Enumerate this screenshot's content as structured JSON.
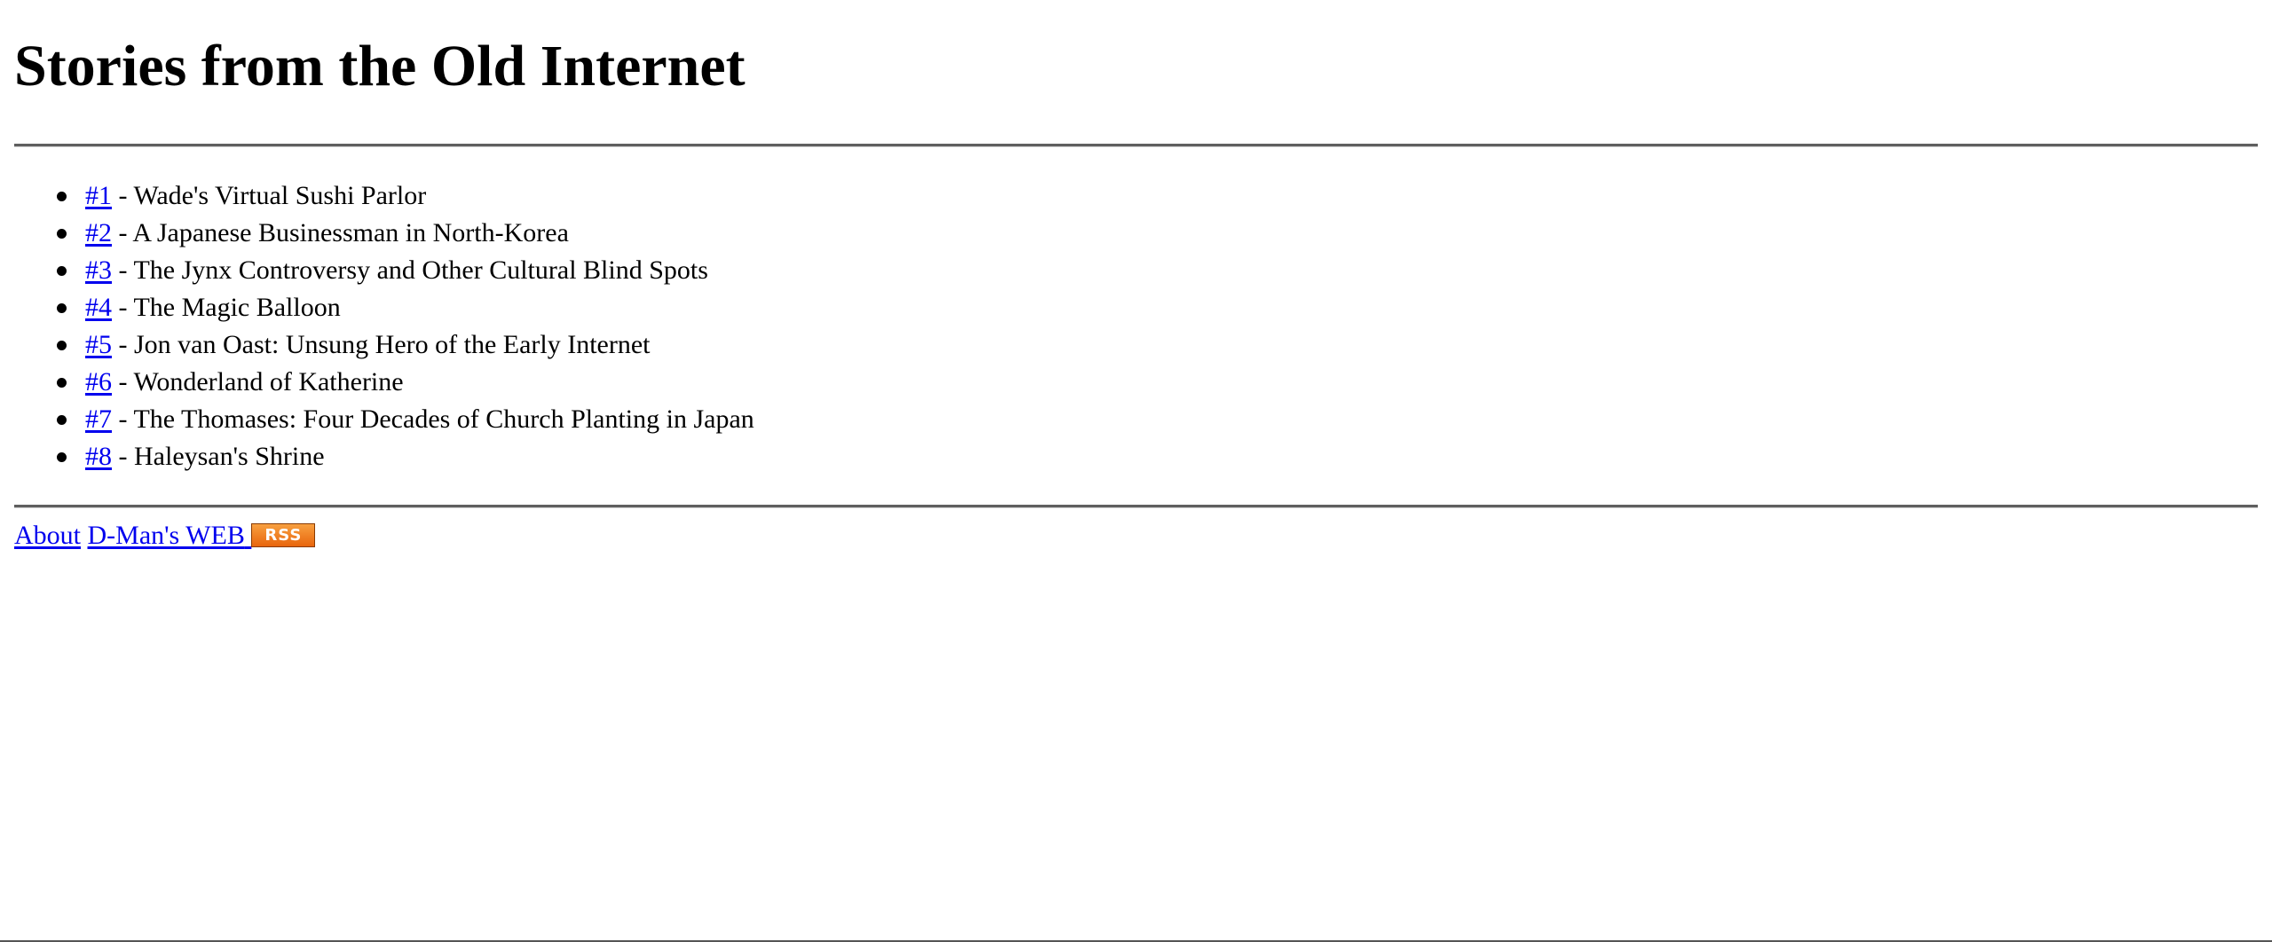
{
  "page": {
    "title": "Stories from the Old Internet"
  },
  "stories": [
    {
      "number": "#1",
      "separator": " - ",
      "title": "Wade's Virtual Sushi Parlor"
    },
    {
      "number": "#2",
      "separator": " - ",
      "title": "A Japanese Businessman in North-Korea"
    },
    {
      "number": "#3",
      "separator": " - ",
      "title": "The Jynx Controversy and Other Cultural Blind Spots"
    },
    {
      "number": "#4",
      "separator": " - ",
      "title": "The Magic Balloon"
    },
    {
      "number": "#5",
      "separator": " - ",
      "title": "Jon van Oast: Unsung Hero of the Early Internet"
    },
    {
      "number": "#6",
      "separator": " - ",
      "title": "Wonderland of Katherine"
    },
    {
      "number": "#7",
      "separator": " - ",
      "title": "The Thomases: Four Decades of Church Planting in Japan"
    },
    {
      "number": "#8",
      "separator": " - ",
      "title": "Haleysan's Shrine"
    }
  ],
  "footer": {
    "about_label": "About",
    "site_label": "D-Man's WEB",
    "rss_label": "RSS",
    "rss_color": "#e8650c"
  },
  "colors": {
    "link": "#0000ee",
    "text": "#000000",
    "rule": "#5f5f5f"
  }
}
